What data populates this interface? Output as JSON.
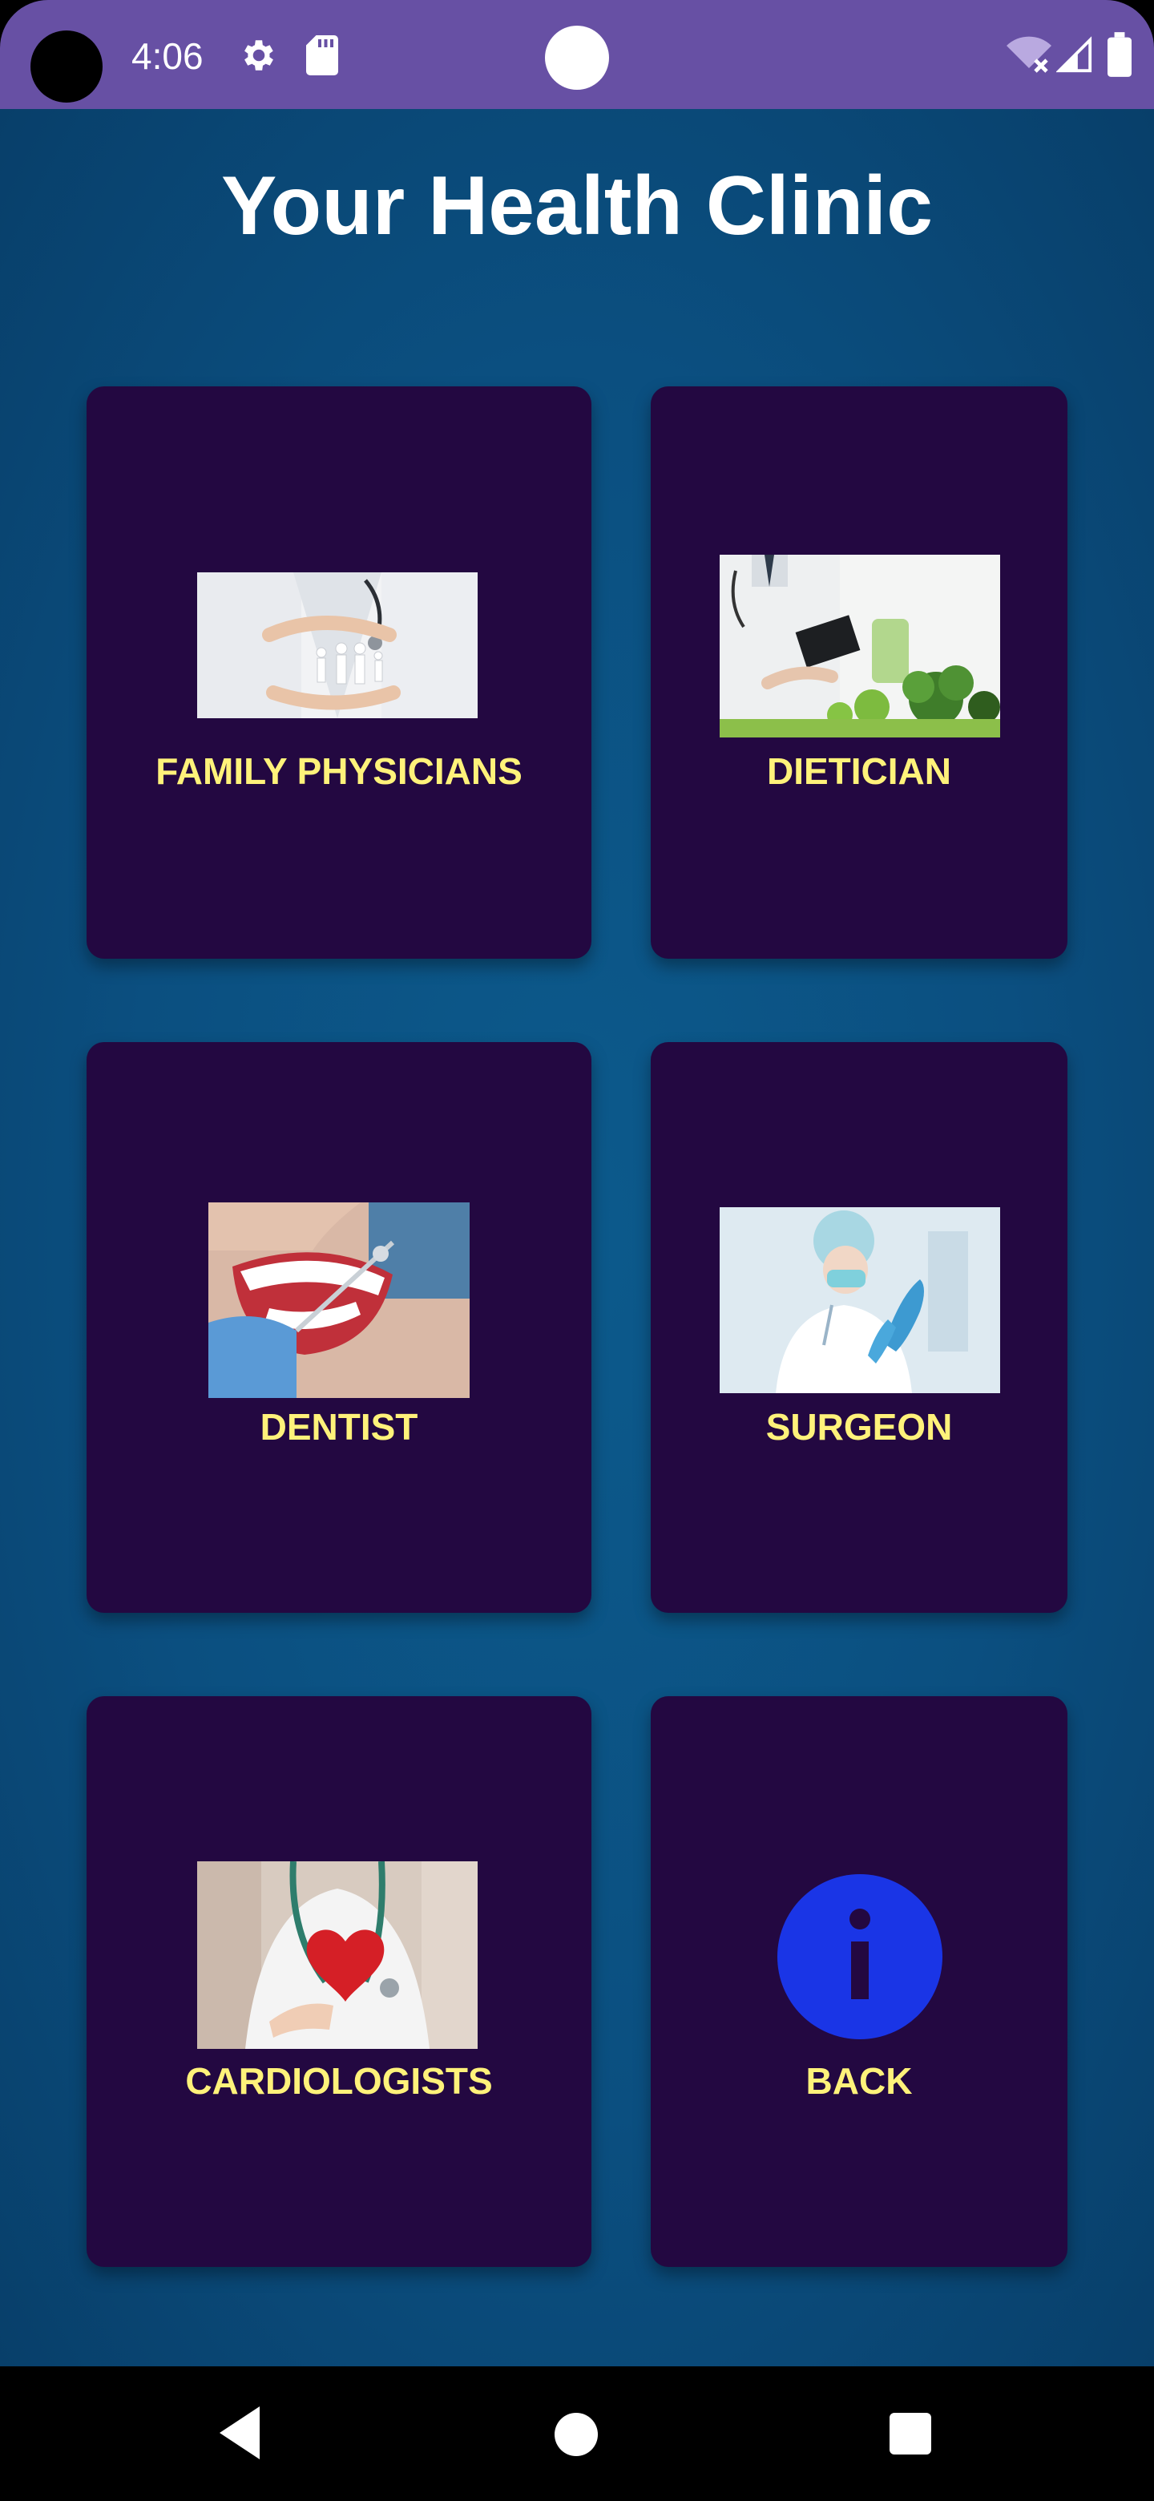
{
  "status_bar": {
    "time": "4:06"
  },
  "app": {
    "title": "Your Health Clinic"
  },
  "cards": [
    {
      "label": "FAMILY PHYSICIANS",
      "icon": "family-care-photo"
    },
    {
      "label": "DIETICIAN",
      "icon": "dietician-photo"
    },
    {
      "label": "DENTIST",
      "icon": "dentist-photo"
    },
    {
      "label": "SURGEON",
      "icon": "surgeon-photo"
    },
    {
      "label": "CARDIOLOGISTS",
      "icon": "cardiology-heart-photo"
    },
    {
      "label": "BACK",
      "icon": "info-icon"
    }
  ],
  "colors": {
    "status_bar": "#6750a4",
    "background": "#0b4f80",
    "card": "#230841",
    "label": "#fff27a",
    "info_circle": "#1a35e6"
  }
}
